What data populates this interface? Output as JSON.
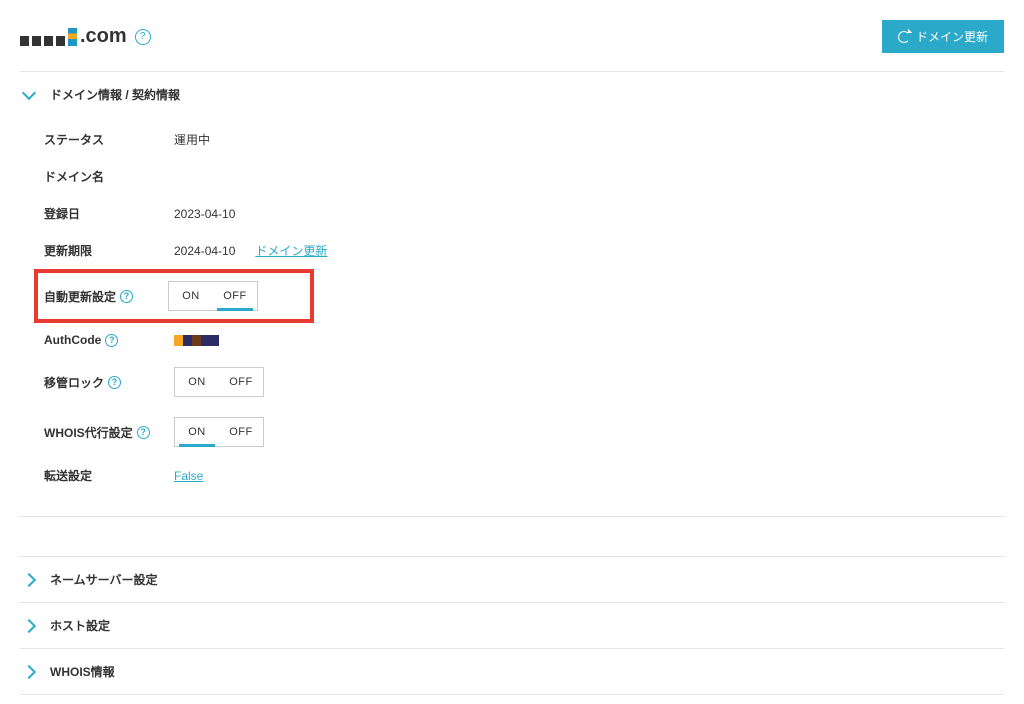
{
  "header": {
    "domain_suffix": ".com",
    "update_btn": "ドメイン更新"
  },
  "sections": {
    "domain_info": {
      "title": "ドメイン情報 / 契約情報",
      "rows": {
        "status_label": "ステータス",
        "status_value": "運用中",
        "domain_name_label": "ドメイン名",
        "reg_date_label": "登録日",
        "reg_date_value": "2023-04-10",
        "exp_date_label": "更新期限",
        "exp_date_value": "2024-04-10",
        "exp_link": "ドメイン更新",
        "auto_renew_label": "自動更新設定",
        "authcode_label": "AuthCode",
        "transfer_lock_label": "移管ロック",
        "whois_proxy_label": "WHOIS代行設定",
        "forward_label": "転送設定",
        "forward_value": "False"
      }
    },
    "nameserver": {
      "title": "ネームサーバー設定"
    },
    "host": {
      "title": "ホスト設定"
    },
    "whois": {
      "title": "WHOIS情報"
    }
  },
  "toggle": {
    "on": "ON",
    "off": "OFF"
  }
}
